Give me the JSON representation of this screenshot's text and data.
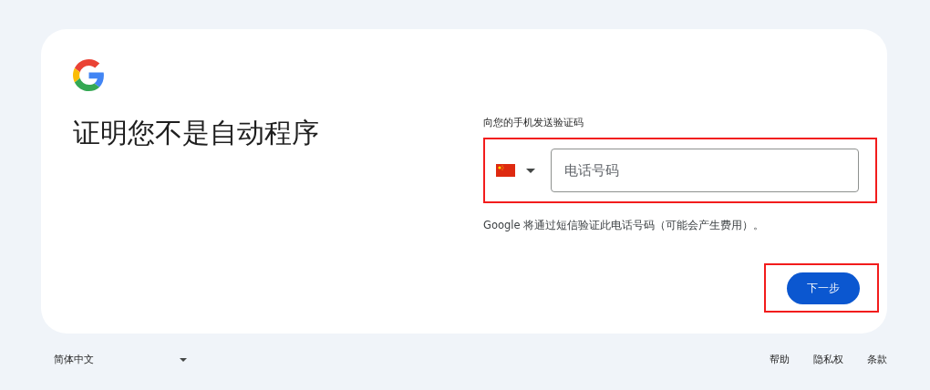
{
  "card": {
    "title": "证明您不是自动程序",
    "phone_label": "向您的手机发送验证码",
    "phone_field": {
      "placeholder": "电话号码"
    },
    "hint": "Google 将通过短信验证此电话号码（可能会产生费用）。",
    "next_button": "下一步"
  },
  "footer": {
    "language": "简体中文",
    "links": [
      "帮助",
      "隐私权",
      "条款"
    ]
  }
}
